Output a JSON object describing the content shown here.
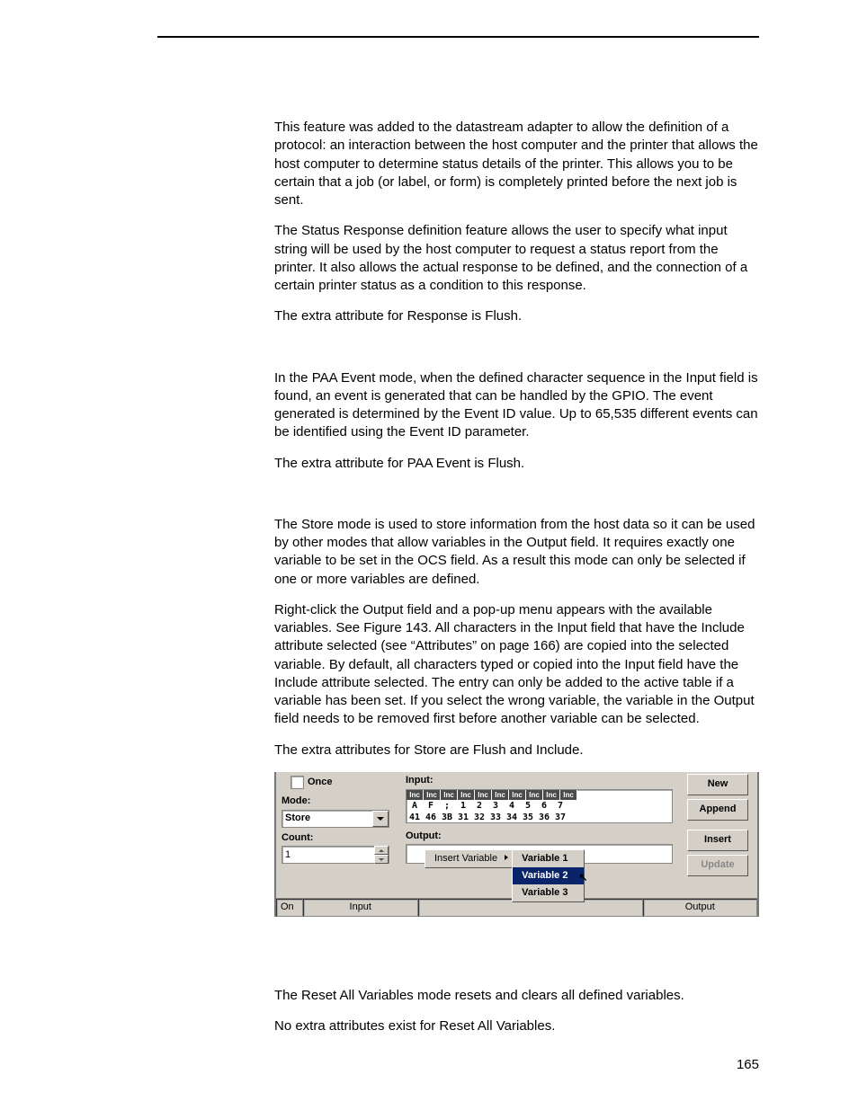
{
  "paragraphs": {
    "p1": "This feature was added to the datastream adapter to allow the definition of a protocol: an interaction between the host computer and the printer that allows the host computer to determine status details of the printer. This allows you to be certain that a job (or label, or form) is completely printed before the next job is sent.",
    "p2": "The Status Response definition feature allows the user to specify what input string will be used by the host computer to request a status report from the printer. It also allows the actual response to be defined, and the connection of a certain printer status as a condition to this response.",
    "p3": "The extra attribute for Response is Flush.",
    "p4": "In the PAA Event mode, when the defined character sequence in the Input field is found, an event is generated that can be handled by the GPIO. The event generated is determined by the Event ID value. Up to 65,535 different events can be identified using the Event ID parameter.",
    "p5": "The extra attribute for PAA Event is Flush.",
    "p6": "The Store mode is used to store information from the host data so it can be used by other modes that allow variables in the Output field. It requires exactly one variable to be set in the OCS field. As a result this mode can only be selected if one or more variables are defined.",
    "p7": "Right-click the Output field and a pop-up menu appears with the available variables. See Figure 143. All characters in the Input field that have the Include attribute selected (see “Attributes” on page 166) are copied into the selected variable. By default, all characters typed or copied into the Input field have the Include attribute selected. The entry can only be added to the active table if a variable has been set. If you select the wrong variable, the variable in the Output field needs to be removed first before another variable can be selected.",
    "p8": "The extra attributes for Store are Flush and Include.",
    "p9": "The Reset All Variables mode resets and clears all defined variables.",
    "p10": "No extra attributes exist for Reset All Variables."
  },
  "figure": {
    "once_label": "Once",
    "mode_label": "Mode:",
    "mode_value": "Store",
    "count_label": "Count:",
    "count_value": "1",
    "input_label": "Input:",
    "output_label": "Output:",
    "inc_tag": "Inc",
    "chars": [
      "A",
      "F",
      ";",
      "1",
      "2",
      "3",
      "4",
      "5",
      "6",
      "7"
    ],
    "hex": [
      "41",
      "46",
      "3B",
      "31",
      "32",
      "33",
      "34",
      "35",
      "36",
      "37"
    ],
    "buttons": {
      "new": "New",
      "append": "Append",
      "insert": "Insert",
      "update": "Update"
    },
    "context_menu": {
      "insert_variable": "Insert Variable",
      "vars": [
        "Variable 1",
        "Variable 2",
        "Variable 3"
      ]
    },
    "status": {
      "on": "On",
      "input": "Input",
      "output": "Output"
    }
  },
  "page_number": "165"
}
